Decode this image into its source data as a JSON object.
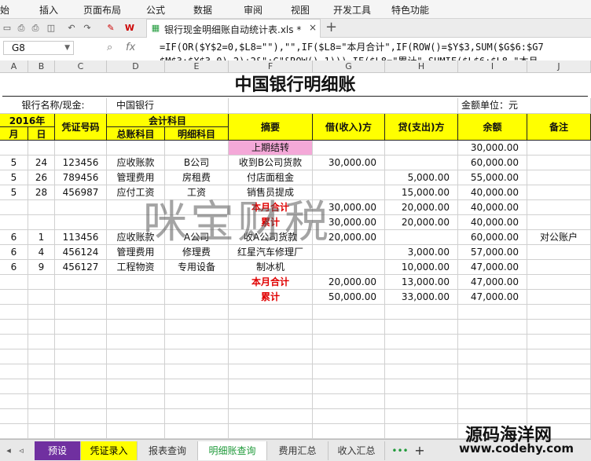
{
  "menu": [
    "始",
    "插入",
    "页面布局",
    "公式",
    "数据",
    "审阅",
    "视图",
    "开发工具",
    "特色功能"
  ],
  "doc_tab": {
    "filename": "银行现金明细账自动统计表.xls *",
    "close": "×",
    "new_tab": "+"
  },
  "formula_bar": {
    "cell_ref": "G8",
    "fx": "fx",
    "line1": "=IF(OR($Y$2=0,$L8=\"\"),\"\",IF($L8=\"本月合计\",IF(ROW()=$Y$3,SUM($G$6:$G7",
    "line2": "$M$3:$X$3,0)-2)+2&\":G\"&ROW()-1))),IF($L8=\"累计\",SUMIF($L$6:$L8,\"本月"
  },
  "columns": [
    "A",
    "B",
    "C",
    "D",
    "E",
    "F",
    "G",
    "H",
    "I",
    "J"
  ],
  "sheet": {
    "title": "中国银行明细账",
    "bank_label": "银行名称/现金:",
    "bank_value": "中国银行",
    "unit_label": "金额单位：元",
    "headers": {
      "year": "2016年",
      "month": "月",
      "day": "日",
      "voucher": "凭证号码",
      "subject": "会计科目",
      "general": "总账科目",
      "detail": "明细科目",
      "summary": "摘要",
      "debit": "借(收入)方",
      "credit": "贷(支出)方",
      "balance": "余额",
      "note": "备注"
    },
    "rows": [
      {
        "m": "",
        "d": "",
        "v": "",
        "g": "",
        "dt": "",
        "s": "上期结转",
        "debit": "",
        "credit": "",
        "bal": "30,000.00",
        "note": "",
        "style": "carry"
      },
      {
        "m": "5",
        "d": "24",
        "v": "123456",
        "g": "应收账款",
        "dt": "B公司",
        "s": "收到B公司货款",
        "debit": "30,000.00",
        "credit": "",
        "bal": "60,000.00",
        "note": "",
        "style": ""
      },
      {
        "m": "5",
        "d": "26",
        "v": "789456",
        "g": "管理费用",
        "dt": "房租费",
        "s": "付店面租金",
        "debit": "",
        "credit": "5,000.00",
        "bal": "55,000.00",
        "note": "",
        "style": ""
      },
      {
        "m": "5",
        "d": "28",
        "v": "456987",
        "g": "应付工资",
        "dt": "工资",
        "s": "销售员提成",
        "debit": "",
        "credit": "15,000.00",
        "bal": "40,000.00",
        "note": "",
        "style": ""
      },
      {
        "m": "",
        "d": "",
        "v": "",
        "g": "",
        "dt": "",
        "s": "本月合计",
        "debit": "30,000.00",
        "credit": "20,000.00",
        "bal": "40,000.00",
        "note": "",
        "style": "total"
      },
      {
        "m": "",
        "d": "",
        "v": "",
        "g": "",
        "dt": "",
        "s": "累计",
        "debit": "30,000.00",
        "credit": "20,000.00",
        "bal": "40,000.00",
        "note": "",
        "style": "total"
      },
      {
        "m": "6",
        "d": "1",
        "v": "113456",
        "g": "应收账款",
        "dt": "A公司",
        "s": "收A公司货款",
        "debit": "20,000.00",
        "credit": "",
        "bal": "60,000.00",
        "note": "对公账户",
        "style": ""
      },
      {
        "m": "6",
        "d": "4",
        "v": "456124",
        "g": "管理费用",
        "dt": "修理费",
        "s": "红星汽车修理厂",
        "debit": "",
        "credit": "3,000.00",
        "bal": "57,000.00",
        "note": "",
        "style": ""
      },
      {
        "m": "6",
        "d": "9",
        "v": "456127",
        "g": "工程物资",
        "dt": "专用设备",
        "s": "制冰机",
        "debit": "",
        "credit": "10,000.00",
        "bal": "47,000.00",
        "note": "",
        "style": ""
      },
      {
        "m": "",
        "d": "",
        "v": "",
        "g": "",
        "dt": "",
        "s": "本月合计",
        "debit": "20,000.00",
        "credit": "13,000.00",
        "bal": "47,000.00",
        "note": "",
        "style": "total"
      },
      {
        "m": "",
        "d": "",
        "v": "",
        "g": "",
        "dt": "",
        "s": "累计",
        "debit": "50,000.00",
        "credit": "33,000.00",
        "bal": "47,000.00",
        "note": "",
        "style": "total"
      }
    ],
    "empty_rows": 9,
    "watermark": "咪宝财税"
  },
  "sheet_tabs": [
    {
      "label": "预设",
      "color": "#7030a0",
      "text": "#ffffff"
    },
    {
      "label": "凭证录入",
      "color": "#ffff00",
      "text": "#000000"
    },
    {
      "label": "报表查询",
      "color": "#e8e8e8",
      "text": "#333333"
    },
    {
      "label": "明细账查询",
      "color": "#ffffff",
      "text": "#1f9a3a"
    },
    {
      "label": "费用汇总",
      "color": "#e8e8e8",
      "text": "#333333"
    },
    {
      "label": "收入汇总",
      "color": "#e8e8e8",
      "text": "#333333"
    }
  ],
  "sheet_more": "•••",
  "sheet_add": "+",
  "site_watermark": {
    "name": "源码海洋网",
    "url": "www.codehy.com"
  },
  "colors": {
    "header_fill": "#ffff00",
    "carry_fill": "#f4a8d8",
    "total_text": "#e00000"
  }
}
